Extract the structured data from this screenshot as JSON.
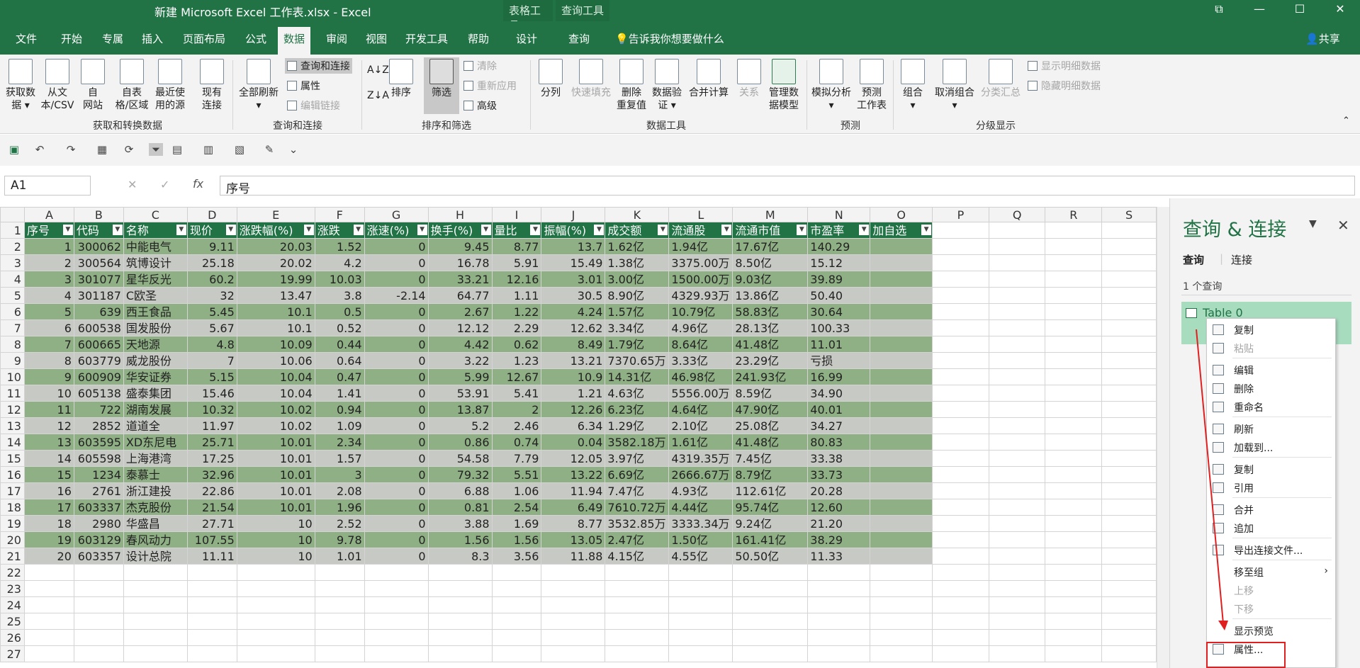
{
  "window": {
    "title": "新建 Microsoft Excel 工作表.xlsx  -  Excel",
    "context_tools": [
      "表格工具",
      "查询工具"
    ],
    "controls": [
      "restore-icon",
      "minimize-icon",
      "maximize-icon",
      "close-icon"
    ]
  },
  "tabs": [
    "文件",
    "开始",
    "专属",
    "插入",
    "页面布局",
    "公式",
    "数据",
    "审阅",
    "视图",
    "开发工具",
    "帮助",
    "设计",
    "查询"
  ],
  "tell_me": "告诉我你想要做什么",
  "share": "共享",
  "ribbon": {
    "get": {
      "btn1": "获取数据",
      "btn1b": "据 ▾",
      "btn1a": "获取数",
      "btn2a": "从文",
      "btn2b": "本/CSV",
      "btn3a": "自",
      "btn3b": "网站",
      "btn4a": "自表",
      "btn4b": "格/区域",
      "btn5a": "最近使",
      "btn5b": "用的源",
      "btn6a": "现有",
      "btn6b": "连接",
      "group": "获取和转换数据"
    },
    "qc": {
      "refresh_a": "全部刷新",
      "refresh_b": "▾",
      "item1": "查询和连接",
      "item2": "属性",
      "item3": "编辑链接",
      "group": "查询和连接"
    },
    "sort": {
      "sort": "排序",
      "filter": "筛选",
      "clear": "清除",
      "reapply": "重新应用",
      "advanced": "高级",
      "group": "排序和筛选"
    },
    "tools": {
      "b1": "分列",
      "b2": "快速填充",
      "b3a": "删除",
      "b3b": "重复值",
      "b4a": "数据验",
      "b4b": "证 ▾",
      "b5": "合并计算",
      "b6": "关系",
      "b7a": "管理数",
      "b7b": "据模型",
      "group": "数据工具"
    },
    "forecast": {
      "b1a": "模拟分析",
      "b1b": "▾",
      "b2a": "预测",
      "b2b": "工作表",
      "group": "预测"
    },
    "outline": {
      "b1a": "组合",
      "b1b": "▾",
      "b2a": "取消组合",
      "b2b": "▾",
      "b3": "分类汇总",
      "s1": "显示明细数据",
      "s2": "隐藏明细数据",
      "group": "分级显示"
    }
  },
  "namebox": "A1",
  "formula": "序号",
  "columns": [
    "A",
    "B",
    "C",
    "D",
    "E",
    "F",
    "G",
    "H",
    "I",
    "J",
    "K",
    "L",
    "M",
    "N",
    "O",
    "P",
    "Q",
    "R",
    "S"
  ],
  "table": {
    "headers": [
      "序号",
      "代码",
      "名称",
      "现价",
      "涨跌幅(%)",
      "涨跌",
      "涨速(%)",
      "换手(%)",
      "量比",
      "振幅(%)",
      "成交额",
      "流通股",
      "流通市值",
      "市盈率",
      "加自选"
    ],
    "rows": [
      [
        "1",
        "300062",
        "中能电气",
        "9.11",
        "20.03",
        "1.52",
        "0",
        "9.45",
        "8.77",
        "13.7",
        "1.62亿",
        "1.94亿",
        "17.67亿",
        "140.29",
        ""
      ],
      [
        "2",
        "300564",
        "筑博设计",
        "25.18",
        "20.02",
        "4.2",
        "0",
        "16.78",
        "5.91",
        "15.49",
        "1.38亿",
        "3375.00万",
        "8.50亿",
        "15.12",
        ""
      ],
      [
        "3",
        "301077",
        "星华反光",
        "60.2",
        "19.99",
        "10.03",
        "0",
        "33.21",
        "12.16",
        "3.01",
        "3.00亿",
        "1500.00万",
        "9.03亿",
        "39.89",
        ""
      ],
      [
        "4",
        "301187",
        "C欧圣",
        "32",
        "13.47",
        "3.8",
        "-2.14",
        "64.77",
        "1.11",
        "30.5",
        "8.90亿",
        "4329.93万",
        "13.86亿",
        "50.40",
        ""
      ],
      [
        "5",
        "639",
        "西王食品",
        "5.45",
        "10.1",
        "0.5",
        "0",
        "2.67",
        "1.22",
        "4.24",
        "1.57亿",
        "10.79亿",
        "58.83亿",
        "30.64",
        ""
      ],
      [
        "6",
        "600538",
        "国发股份",
        "5.67",
        "10.1",
        "0.52",
        "0",
        "12.12",
        "2.29",
        "12.62",
        "3.34亿",
        "4.96亿",
        "28.13亿",
        "100.33",
        ""
      ],
      [
        "7",
        "600665",
        "天地源",
        "4.8",
        "10.09",
        "0.44",
        "0",
        "4.42",
        "0.62",
        "8.49",
        "1.79亿",
        "8.64亿",
        "41.48亿",
        "11.01",
        ""
      ],
      [
        "8",
        "603779",
        "威龙股份",
        "7",
        "10.06",
        "0.64",
        "0",
        "3.22",
        "1.23",
        "13.21",
        "7370.65万",
        "3.33亿",
        "23.29亿",
        "亏损",
        ""
      ],
      [
        "9",
        "600909",
        "华安证券",
        "5.15",
        "10.04",
        "0.47",
        "0",
        "5.99",
        "12.67",
        "10.9",
        "14.31亿",
        "46.98亿",
        "241.93亿",
        "16.99",
        ""
      ],
      [
        "10",
        "605138",
        "盛泰集团",
        "15.46",
        "10.04",
        "1.41",
        "0",
        "53.91",
        "5.41",
        "1.21",
        "4.63亿",
        "5556.00万",
        "8.59亿",
        "34.90",
        ""
      ],
      [
        "11",
        "722",
        "湖南发展",
        "10.32",
        "10.02",
        "0.94",
        "0",
        "13.87",
        "2",
        "12.26",
        "6.23亿",
        "4.64亿",
        "47.90亿",
        "40.01",
        ""
      ],
      [
        "12",
        "2852",
        "道道全",
        "11.97",
        "10.02",
        "1.09",
        "0",
        "5.2",
        "2.46",
        "6.34",
        "1.29亿",
        "2.10亿",
        "25.08亿",
        "34.27",
        ""
      ],
      [
        "13",
        "603595",
        "XD东尼电",
        "25.71",
        "10.01",
        "2.34",
        "0",
        "0.86",
        "0.74",
        "0.04",
        "3582.18万",
        "1.61亿",
        "41.48亿",
        "80.83",
        ""
      ],
      [
        "14",
        "605598",
        "上海港湾",
        "17.25",
        "10.01",
        "1.57",
        "0",
        "54.58",
        "7.79",
        "12.05",
        "3.97亿",
        "4319.35万",
        "7.45亿",
        "33.38",
        ""
      ],
      [
        "15",
        "1234",
        "泰慕士",
        "32.96",
        "10.01",
        "3",
        "0",
        "79.32",
        "5.51",
        "13.22",
        "6.69亿",
        "2666.67万",
        "8.79亿",
        "33.73",
        ""
      ],
      [
        "16",
        "2761",
        "浙江建投",
        "22.86",
        "10.01",
        "2.08",
        "0",
        "6.88",
        "1.06",
        "11.94",
        "7.47亿",
        "4.93亿",
        "112.61亿",
        "20.28",
        ""
      ],
      [
        "17",
        "603337",
        "杰克股份",
        "21.54",
        "10.01",
        "1.96",
        "0",
        "0.81",
        "2.54",
        "6.49",
        "7610.72万",
        "4.44亿",
        "95.74亿",
        "12.60",
        ""
      ],
      [
        "18",
        "2980",
        "华盛昌",
        "27.71",
        "10",
        "2.52",
        "0",
        "3.88",
        "1.69",
        "8.77",
        "3532.85万",
        "3333.34万",
        "9.24亿",
        "21.20",
        ""
      ],
      [
        "19",
        "603129",
        "春风动力",
        "107.55",
        "10",
        "9.78",
        "0",
        "1.56",
        "1.56",
        "13.05",
        "2.47亿",
        "1.50亿",
        "161.41亿",
        "38.29",
        ""
      ],
      [
        "20",
        "603357",
        "设计总院",
        "11.11",
        "10",
        "1.01",
        "0",
        "8.3",
        "3.56",
        "11.88",
        "4.15亿",
        "4.55亿",
        "50.50亿",
        "11.33",
        ""
      ]
    ]
  },
  "pane": {
    "title": "查询 & 连接",
    "tab_queries": "查询",
    "tab_connections": "连接",
    "count": "1 个查询",
    "query_name": "Table 0"
  },
  "context_menu": [
    {
      "label": "复制",
      "icon": "copy-icon",
      "disabled": false
    },
    {
      "label": "粘贴",
      "icon": "paste-icon",
      "disabled": true
    },
    {
      "sep": true
    },
    {
      "label": "编辑",
      "icon": "edit-icon",
      "disabled": false
    },
    {
      "label": "删除",
      "icon": "delete-icon",
      "disabled": false
    },
    {
      "label": "重命名",
      "icon": "rename-icon",
      "disabled": false
    },
    {
      "sep": true
    },
    {
      "label": "刷新",
      "icon": "refresh-icon",
      "disabled": false
    },
    {
      "label": "加载到...",
      "icon": "load-to-icon",
      "disabled": false
    },
    {
      "sep": true
    },
    {
      "label": "复制",
      "icon": "duplicate-icon",
      "disabled": false
    },
    {
      "label": "引用",
      "icon": "reference-icon",
      "disabled": false
    },
    {
      "sep": true
    },
    {
      "label": "合并",
      "icon": "merge-icon",
      "disabled": false
    },
    {
      "label": "追加",
      "icon": "append-icon",
      "disabled": false
    },
    {
      "sep": true
    },
    {
      "label": "导出连接文件...",
      "icon": "export-icon",
      "disabled": false
    },
    {
      "sep": true
    },
    {
      "label": "移至组",
      "icon": "",
      "disabled": false,
      "submenu": true
    },
    {
      "label": "上移",
      "icon": "",
      "disabled": true
    },
    {
      "label": "下移",
      "icon": "",
      "disabled": true
    },
    {
      "sep": true
    },
    {
      "label": "显示预览",
      "icon": "",
      "disabled": false
    },
    {
      "label": "属性...",
      "icon": "properties-icon",
      "disabled": false
    }
  ],
  "colors": {
    "excel_green": "#217346",
    "band_odd": "#8faf84",
    "band_even": "#c7c9c4",
    "annotation_red": "#e02020"
  }
}
